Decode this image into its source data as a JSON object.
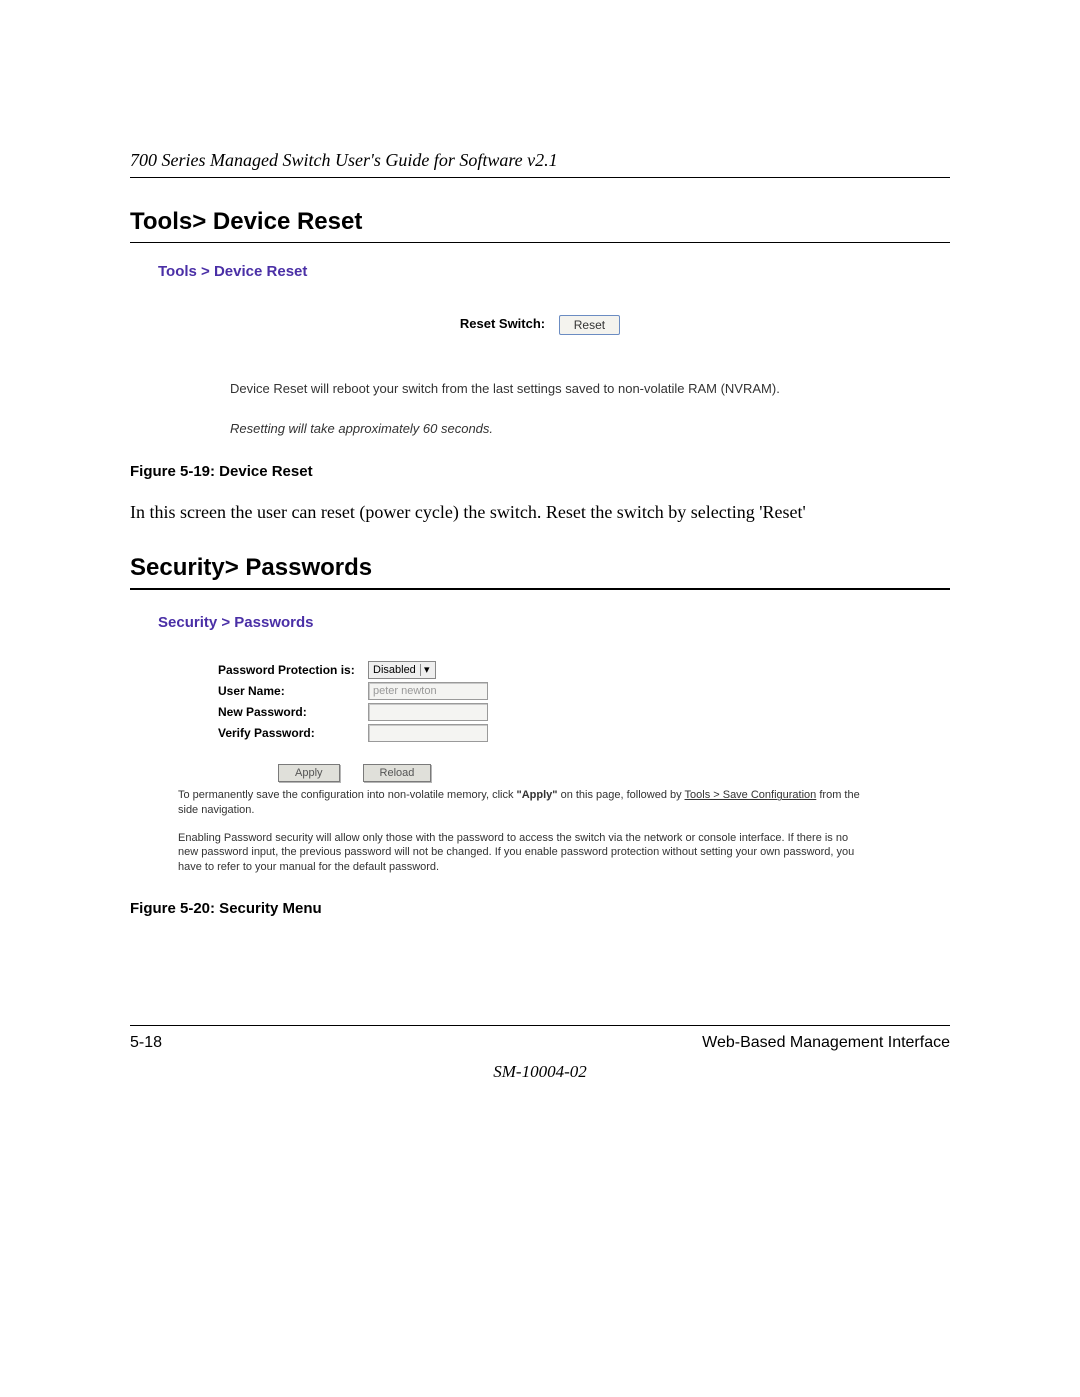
{
  "doc": {
    "running_head": "700 Series Managed Switch User's Guide for Software v2.1",
    "page_number": "5-18",
    "footer_section": "Web-Based Management Interface",
    "doc_id": "SM-10004-02"
  },
  "section1": {
    "heading": "Tools> Device Reset",
    "fig": {
      "breadcrumb": "Tools > Device Reset",
      "reset_label": "Reset Switch:",
      "reset_button": "Reset",
      "description": "Device Reset will reboot your switch from the last settings saved to non-volatile RAM (NVRAM).",
      "note": "Resetting will take approximately 60 seconds."
    },
    "caption": "Figure 5-19:  Device Reset",
    "body": "In this screen the user can reset (power cycle) the switch. Reset the switch by selecting 'Reset'"
  },
  "section2": {
    "heading": "Security> Passwords",
    "fig": {
      "breadcrumb": "Security > Passwords",
      "fields": {
        "protection_label": "Password Protection is:",
        "protection_value": "Disabled",
        "username_label": "User Name:",
        "username_value": "peter newton",
        "newpw_label": "New Password:",
        "verifypw_label": "Verify Password:"
      },
      "apply_button": "Apply",
      "reload_button": "Reload",
      "help1_a": "To permanently save the configuration into non-volatile memory, click ",
      "help1_b": "\"Apply\"",
      "help1_c": " on this page, followed by ",
      "help1_d": "Tools > Save Configuration",
      "help1_e": " from the side navigation.",
      "help2": "Enabling Password security will allow only those with the password to access the switch via the network or console interface. If there is no new password input, the previous password will not be changed. If you enable password protection without setting your own password, you have to refer to your manual for the default password."
    },
    "caption": "Figure 5-20:  Security Menu"
  }
}
